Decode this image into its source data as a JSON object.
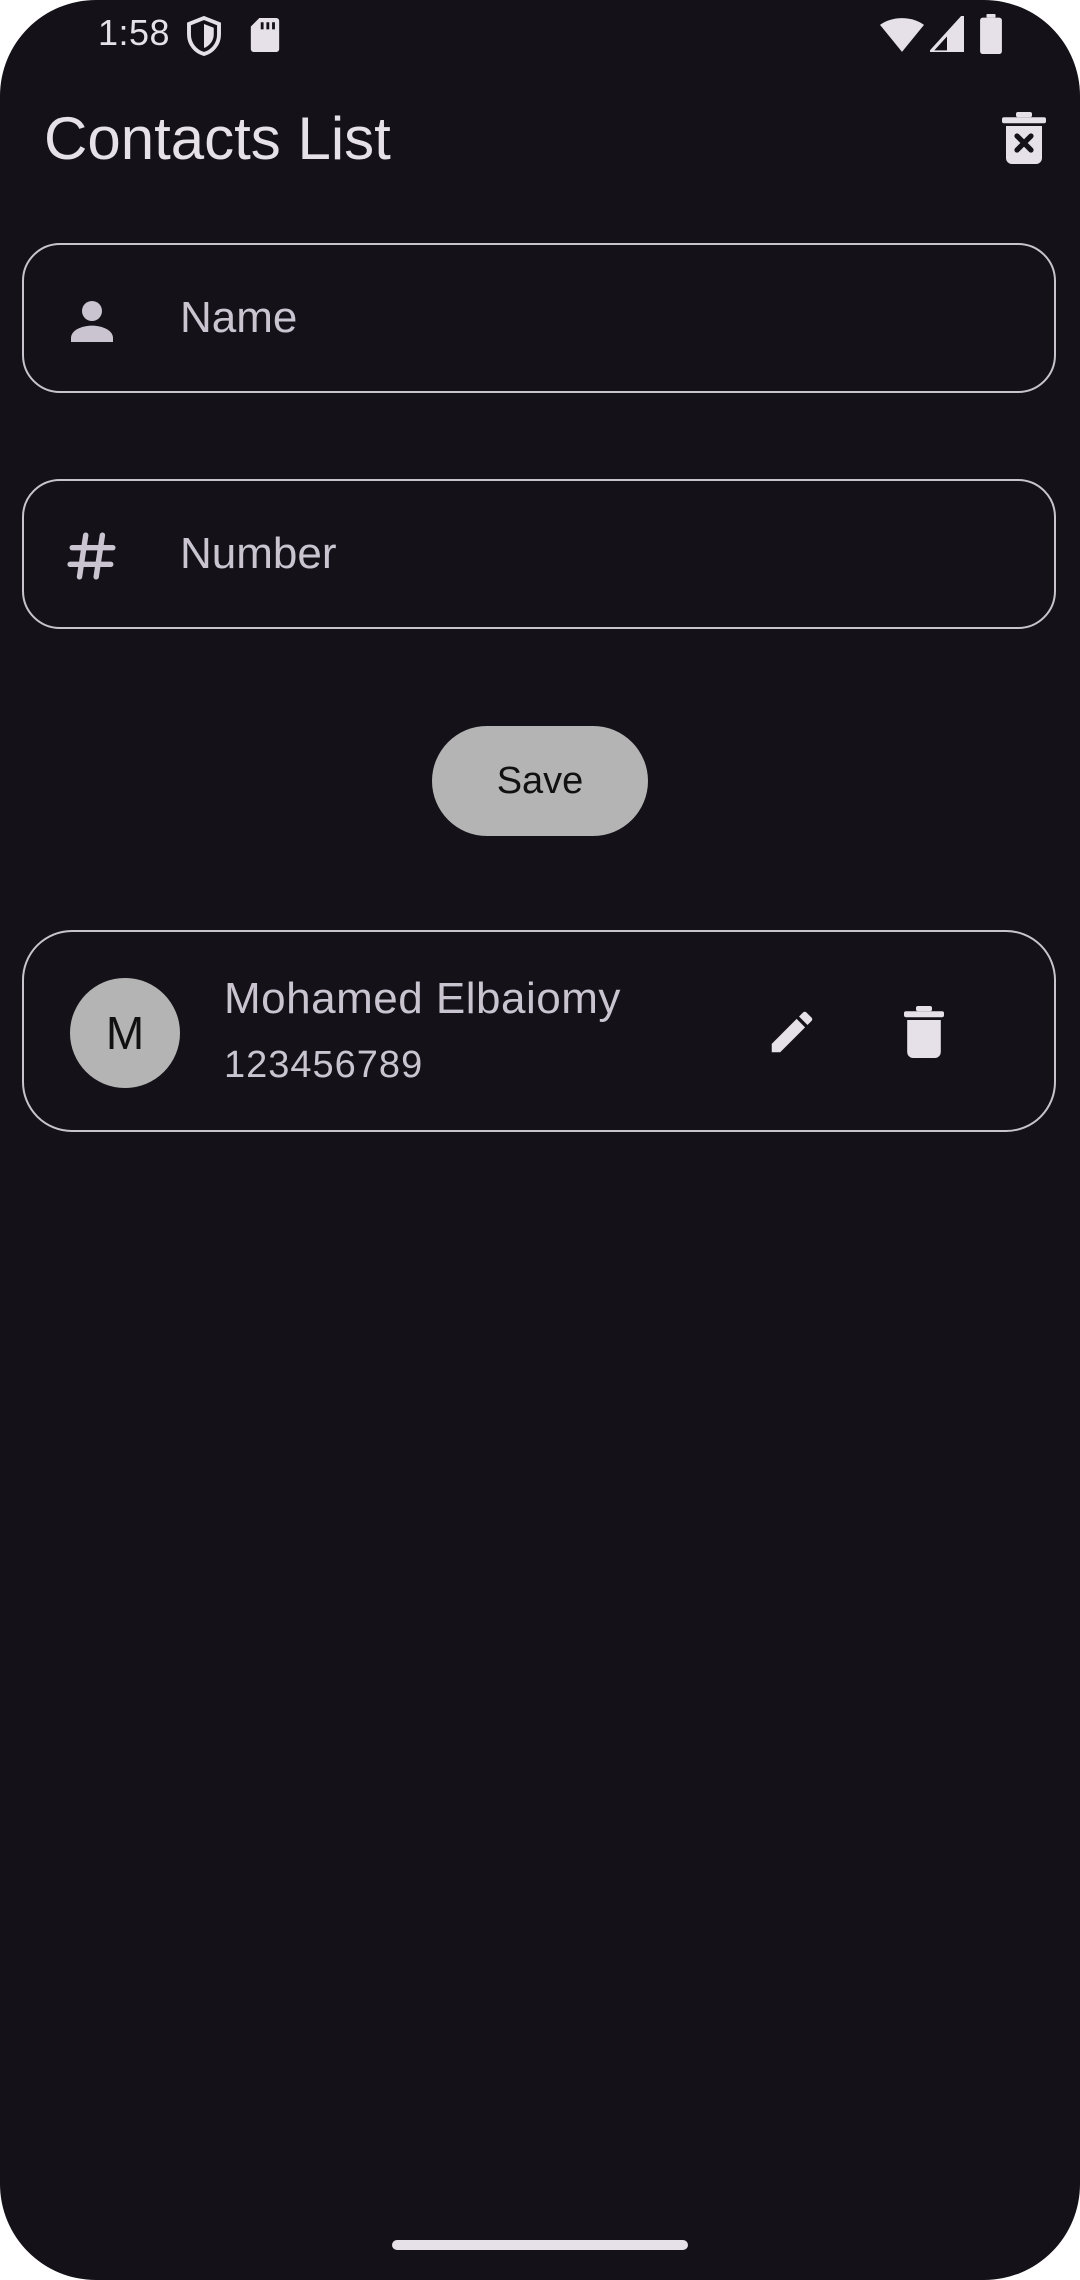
{
  "status_bar": {
    "time": "1:58",
    "left_icons": [
      "shield-icon",
      "sd-card-icon"
    ],
    "right_icons": [
      "wifi-icon",
      "signal-icon",
      "battery-icon"
    ]
  },
  "app_bar": {
    "title": "Contacts List",
    "action_icon": "delete-forever-icon"
  },
  "form": {
    "name_field": {
      "placeholder": "Name",
      "value": "",
      "icon": "person-icon"
    },
    "number_field": {
      "placeholder": "Number",
      "value": "",
      "icon": "hash-icon"
    },
    "save_label": "Save"
  },
  "contacts": [
    {
      "initial": "M",
      "name": "Mohamed Elbaiomy",
      "number": "123456789",
      "actions": [
        "edit-icon",
        "delete-icon"
      ]
    }
  ],
  "colors": {
    "background": "#141218",
    "text": "#e6e0e9",
    "muted_text": "#cac4d0",
    "outline": "#c8c3cc",
    "button_fill": "#b4b4b4"
  }
}
